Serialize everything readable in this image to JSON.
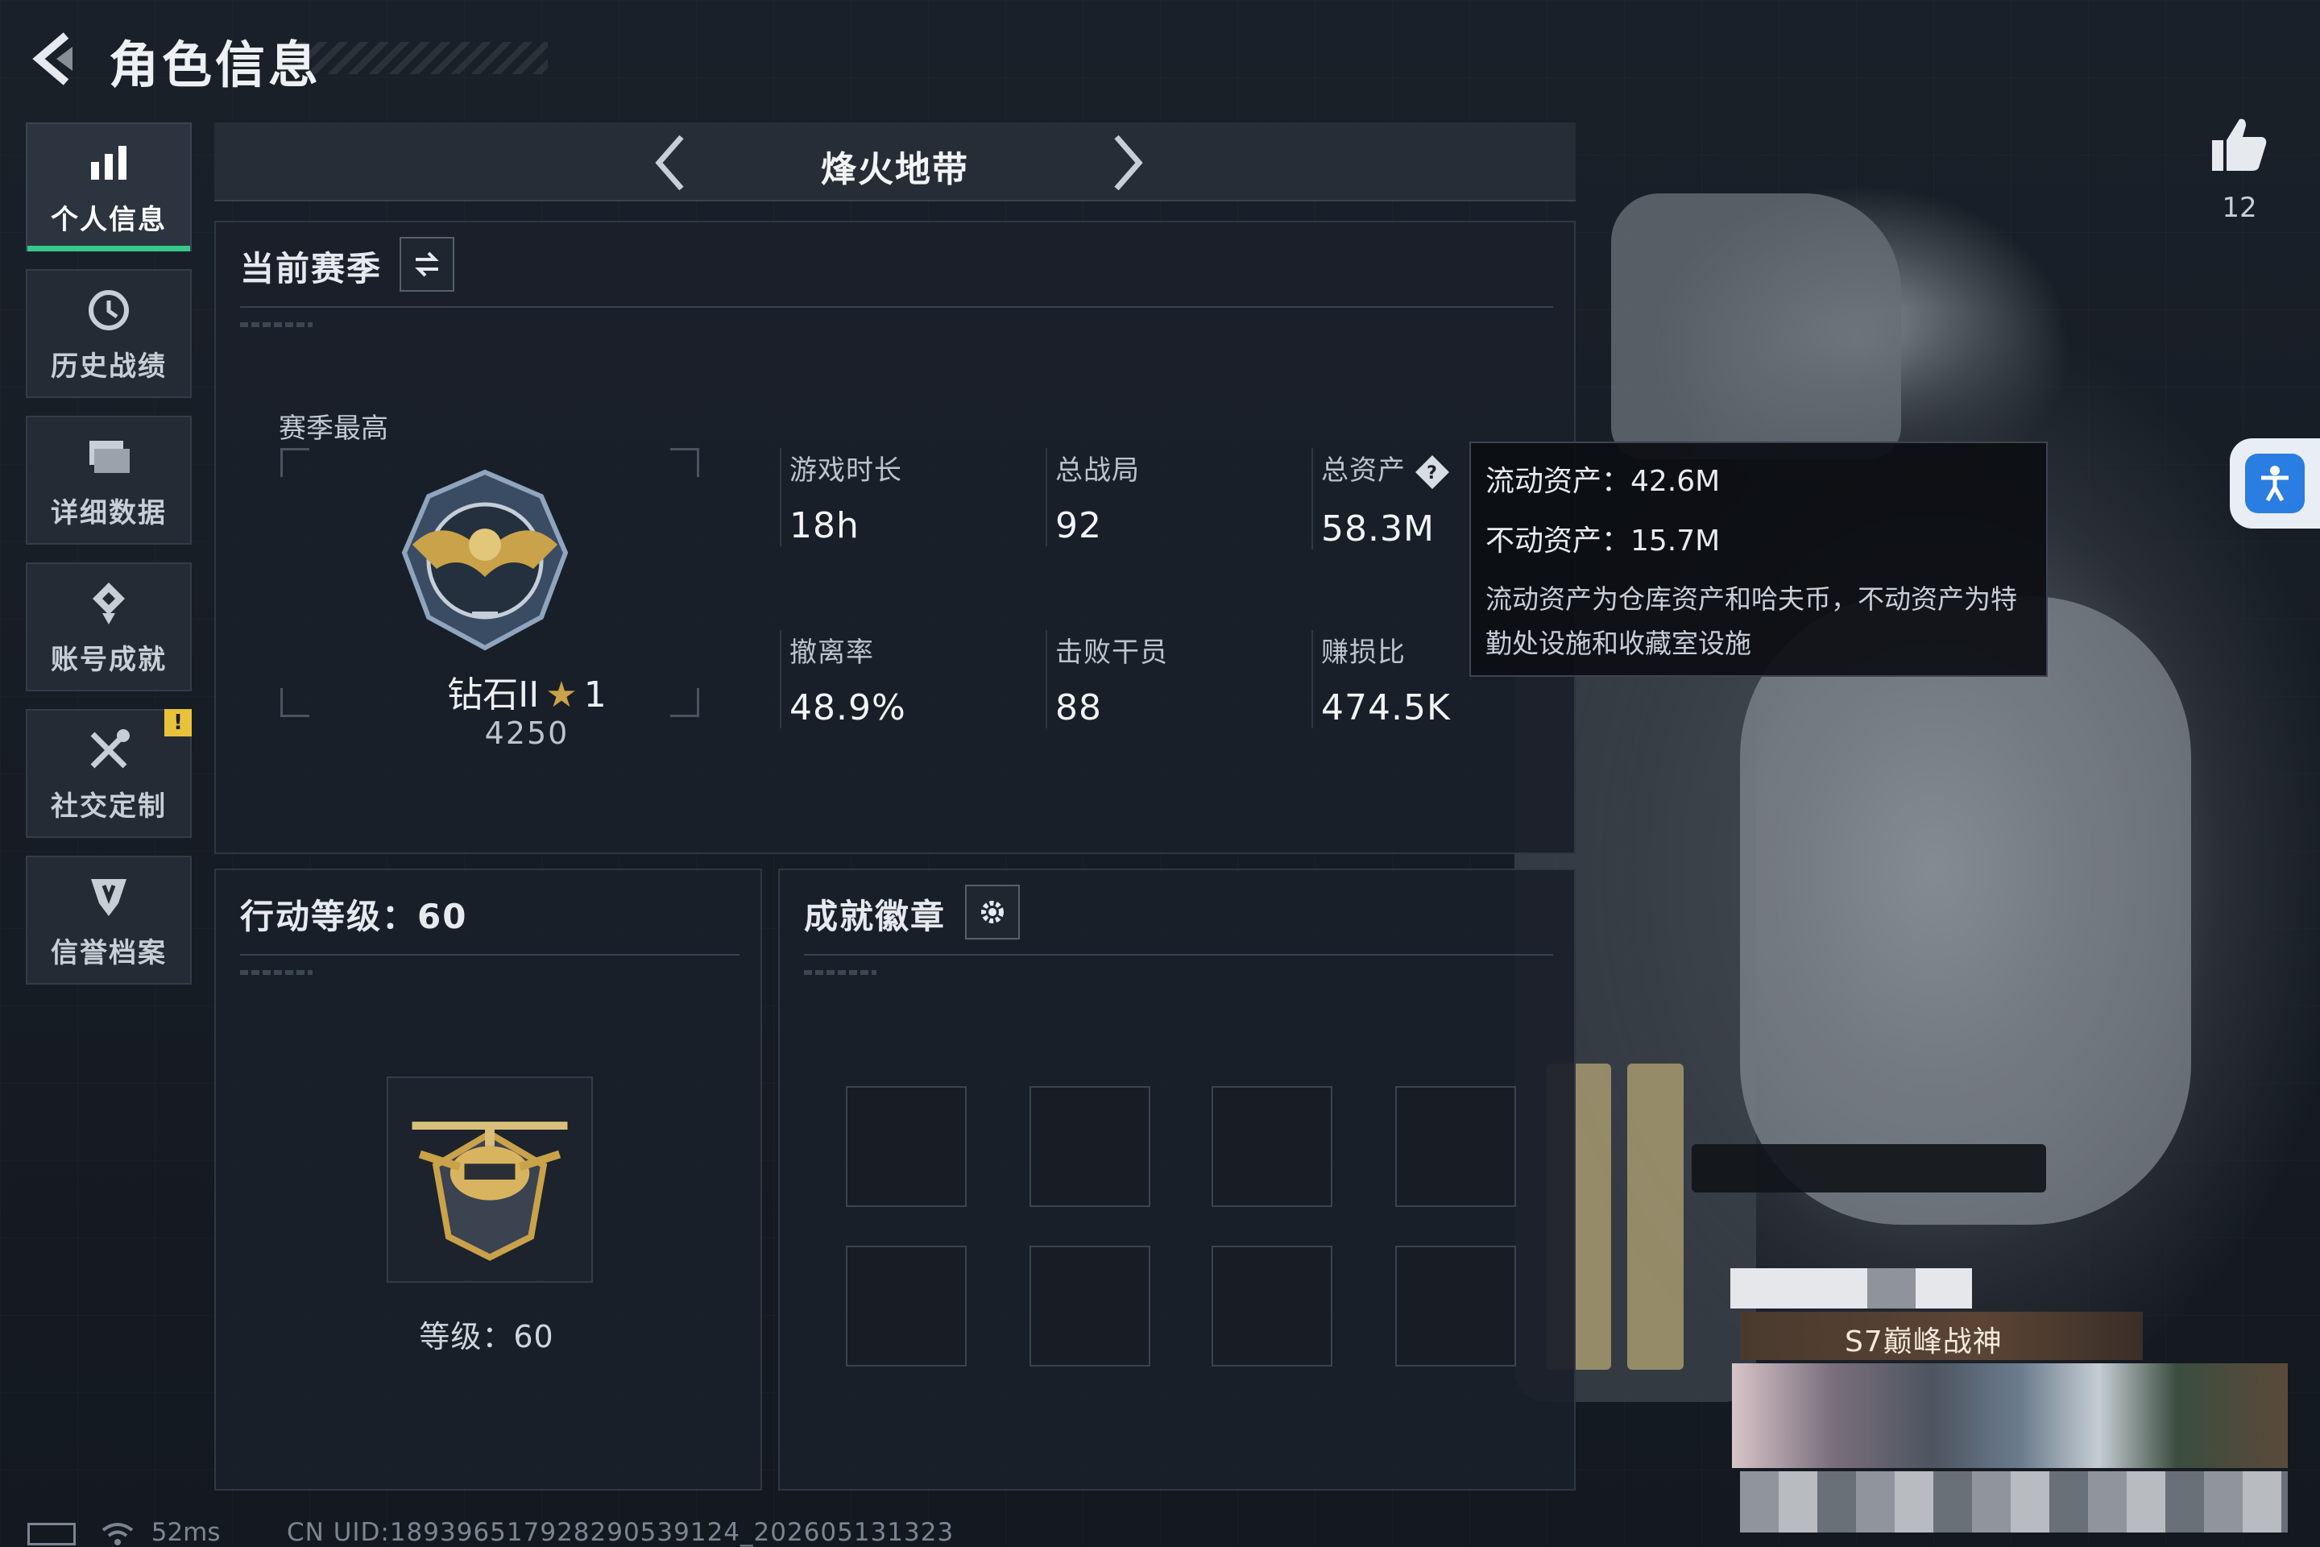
{
  "header": {
    "title": "角色信息"
  },
  "sidebar": {
    "items": [
      {
        "label": "个人信息",
        "icon": "bar-chart-icon",
        "active": true
      },
      {
        "label": "历史战绩",
        "icon": "history-icon"
      },
      {
        "label": "详细数据",
        "icon": "folder-icon"
      },
      {
        "label": "账号成就",
        "icon": "achievement-icon"
      },
      {
        "label": "社交定制",
        "icon": "tools-icon",
        "badge": "!"
      },
      {
        "label": "信誉档案",
        "icon": "shield-icon"
      }
    ]
  },
  "mode": {
    "title": "烽火地带"
  },
  "season": {
    "title": "当前赛季",
    "best_label": "赛季最高",
    "rank": "钻石II",
    "stars": "1",
    "score": "4250"
  },
  "stats": [
    {
      "label": "游戏时长",
      "value": "18h"
    },
    {
      "label": "总战局",
      "value": "92"
    },
    {
      "label": "总资产",
      "value": "58.3M"
    },
    {
      "label": "撤离率",
      "value": "48.9%"
    },
    {
      "label": "击败干员",
      "value": "88"
    },
    {
      "label": "赚损比",
      "value": "474.5K"
    }
  ],
  "tooltip": {
    "liquid": "流动资产：42.6M",
    "fixed": "不动资产：15.7M",
    "desc": "流动资产为仓库资产和哈夫币，不动资产为特勤处设施和收藏室设施"
  },
  "level_panel": {
    "title": "行动等级：60",
    "level_text": "等级：60"
  },
  "badge_panel": {
    "title": "成就徽章"
  },
  "like": {
    "count": "12"
  },
  "profile_card": {
    "title": "S7巅峰战神"
  },
  "status": {
    "ping": "52ms",
    "uid": "CN UID:18939651792829053912​4_202605131323"
  },
  "colors": {
    "accent_green": "#36c98a",
    "warn_yellow": "#e8c23a",
    "gold": "#c9a24a"
  }
}
